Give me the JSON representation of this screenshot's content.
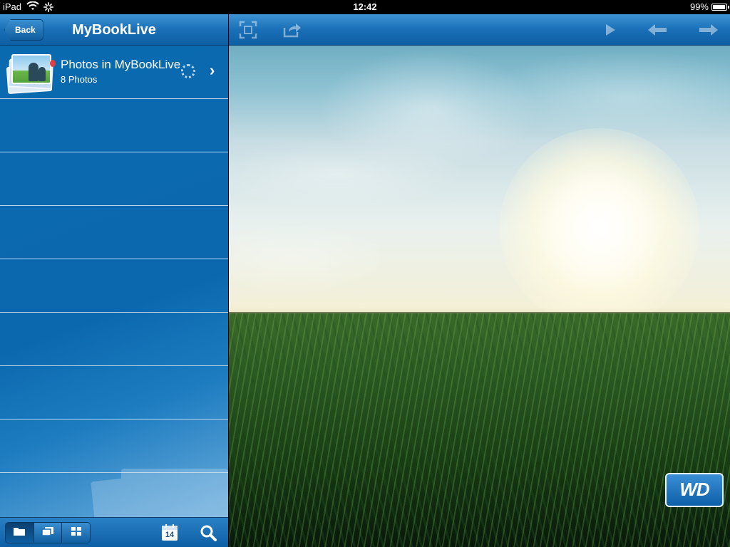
{
  "status_bar": {
    "device": "iPad",
    "time": "12:42",
    "battery": "99%"
  },
  "left_panel": {
    "back_label": "Back",
    "title": "MyBookLive",
    "albums": [
      {
        "title": "Photos in MyBookLive",
        "subtitle": "8 Photos"
      }
    ],
    "toolbar": {
      "segments": [
        "folder-icon",
        "slideshow-icon",
        "grid-icon"
      ],
      "active_segment": "folder-icon",
      "calendar_day": "14"
    }
  },
  "right_panel": {
    "toolbar_icons": [
      "fullscreen-icon",
      "share-icon",
      "play-icon",
      "previous-icon",
      "next-icon"
    ],
    "logo": "WD"
  },
  "colors": {
    "nav_blue": "#1a6fb6",
    "panel_blue": "#0b68ae",
    "separator": "#b8d3ec"
  }
}
